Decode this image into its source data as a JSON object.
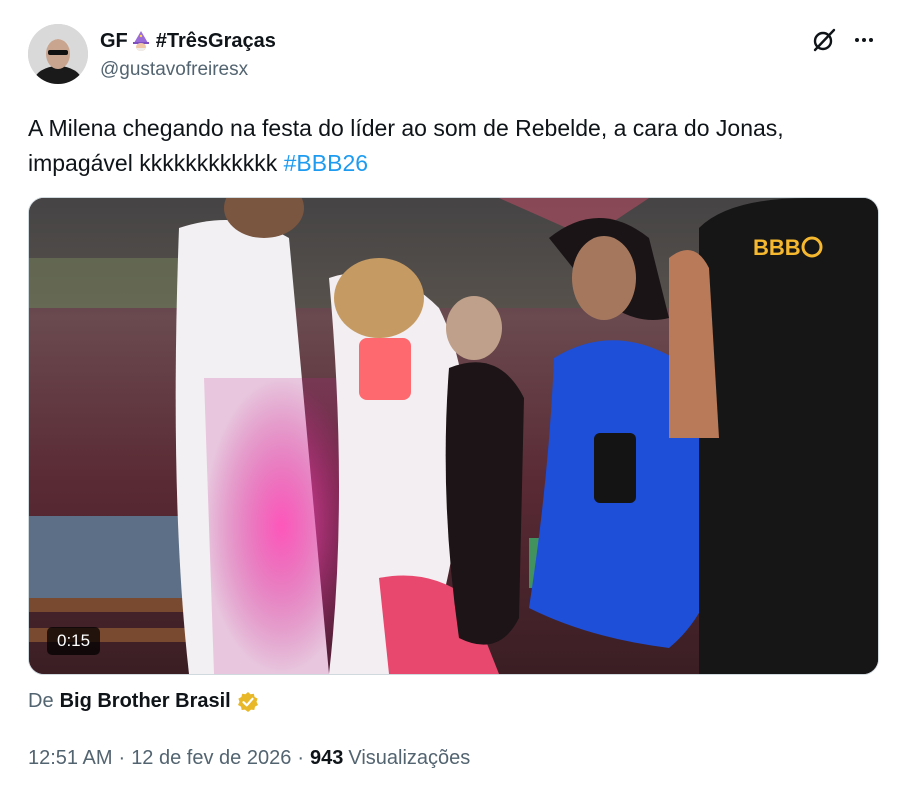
{
  "author": {
    "display_name_prefix": "GF",
    "display_name_suffix": "#TrêsGraças",
    "handle": "@gustavofreiresx"
  },
  "icons": {
    "avatar": "profile-photo",
    "name_emoji": "wizard-emoji",
    "grok": "grok-icon",
    "more": "more-icon",
    "verified": "gold-verified-badge-icon"
  },
  "tweet": {
    "text_main": "A Milena chegando na festa do líder ao som de Rebelde, a cara do Jonas, impagável kkkkkkkkkkkk ",
    "hashtag": "#BBB26"
  },
  "media": {
    "duration": "0:15",
    "watermark": "BBB"
  },
  "source": {
    "prefix": "De",
    "name": "Big Brother Brasil"
  },
  "meta": {
    "time": "12:51 AM",
    "date": "12 de fev de 2026",
    "views_count": "943",
    "views_label": "Visualizações",
    "separator": "·"
  },
  "colors": {
    "accent": "#1d9bf0",
    "secondary_text": "#536471",
    "primary_text": "#0f1419",
    "verified_gold": "#e8b829"
  }
}
